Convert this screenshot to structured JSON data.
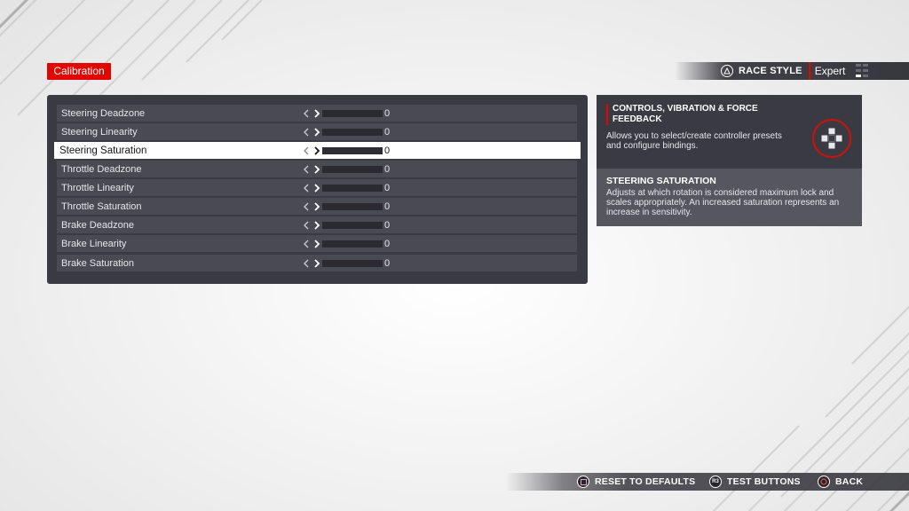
{
  "header": {
    "page_tag": "Calibration",
    "race_style": {
      "label": "RACE STYLE",
      "value": "Expert"
    }
  },
  "settings": {
    "rows": [
      {
        "label": "Steering Deadzone",
        "value": "0",
        "fill": 0,
        "selected": false
      },
      {
        "label": "Steering Linearity",
        "value": "0",
        "fill": 0,
        "selected": false
      },
      {
        "label": "Steering Saturation",
        "value": "0",
        "fill": 0,
        "selected": true
      },
      {
        "label": "Throttle Deadzone",
        "value": "0",
        "fill": 0,
        "selected": false
      },
      {
        "label": "Throttle Linearity",
        "value": "0",
        "fill": 0,
        "selected": false
      },
      {
        "label": "Throttle Saturation",
        "value": "0",
        "fill": 0,
        "selected": false
      },
      {
        "label": "Brake Deadzone",
        "value": "0",
        "fill": 0,
        "selected": false
      },
      {
        "label": "Brake Linearity",
        "value": "0",
        "fill": 0,
        "selected": false
      },
      {
        "label": "Brake Saturation",
        "value": "0",
        "fill": 0,
        "selected": false
      }
    ]
  },
  "info": {
    "section_title": "CONTROLS, VIBRATION & FORCE FEEDBACK",
    "section_desc": "Allows you to select/create controller presets and configure bindings.",
    "item_title": "STEERING SATURATION",
    "item_desc": "Adjusts at which rotation is considered maximum lock and scales appropriately. An increased saturation represents an increase in sensitivity."
  },
  "prompts": {
    "reset": "RESET TO DEFAULTS",
    "r3_badge": "R3",
    "test": "TEST BUTTONS",
    "back": "BACK"
  },
  "colors": {
    "accent": "#e10600",
    "panel": "#3a3a42",
    "row": "#4a4a52"
  },
  "icons": {
    "race_style": "triangle-button-icon",
    "info": "dpad-icon",
    "reset": "square-button-icon",
    "test": "r3-button-icon",
    "back": "circle-button-icon"
  }
}
